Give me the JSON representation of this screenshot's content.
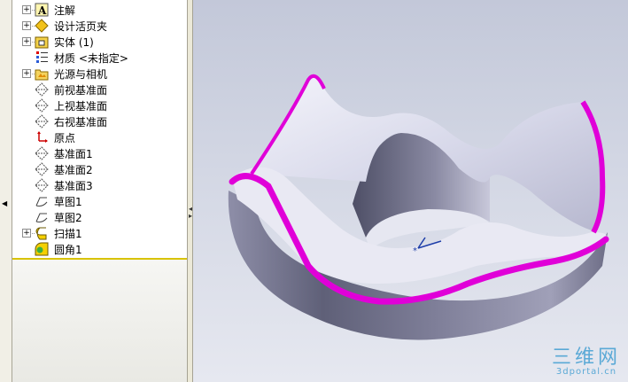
{
  "feature_tree": {
    "items": [
      {
        "label": "注解",
        "icon": "annotation-icon",
        "expandable": true
      },
      {
        "label": "设计活页夹",
        "icon": "design-binder-icon",
        "expandable": true
      },
      {
        "label": "实体 (1)",
        "icon": "solid-body-icon",
        "expandable": true
      },
      {
        "label": "材质 <未指定>",
        "icon": "material-icon",
        "expandable": false
      },
      {
        "label": "光源与相机",
        "icon": "lights-camera-icon",
        "expandable": true
      },
      {
        "label": "前视基准面",
        "icon": "plane-icon",
        "expandable": false
      },
      {
        "label": "上视基准面",
        "icon": "plane-icon",
        "expandable": false
      },
      {
        "label": "右视基准面",
        "icon": "plane-icon",
        "expandable": false
      },
      {
        "label": "原点",
        "icon": "origin-icon",
        "expandable": false
      },
      {
        "label": "基准面1",
        "icon": "plane-icon",
        "expandable": false
      },
      {
        "label": "基准面2",
        "icon": "plane-icon",
        "expandable": false
      },
      {
        "label": "基准面3",
        "icon": "plane-icon",
        "expandable": false
      },
      {
        "label": "草图1",
        "icon": "sketch-icon",
        "expandable": false
      },
      {
        "label": "草图2",
        "icon": "sketch-icon",
        "expandable": false
      },
      {
        "label": "扫描1",
        "icon": "sweep-icon",
        "expandable": true
      },
      {
        "label": "圆角1",
        "icon": "fillet-icon",
        "expandable": false
      }
    ]
  },
  "watermark": {
    "big": "三维网",
    "small": "3dportal.cn"
  },
  "colors": {
    "accent_edge": "#e000d8",
    "tree_divider": "#d9c300",
    "watermark": "#5aa9d6"
  }
}
